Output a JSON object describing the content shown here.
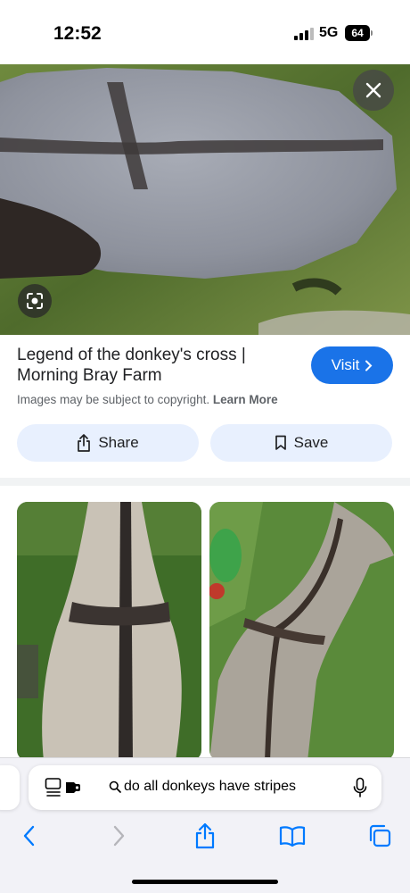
{
  "status_bar": {
    "time": "12:52",
    "network": "5G",
    "battery": "64"
  },
  "hero": {
    "image_icon": "donkey-back-photo",
    "close_icon": "close-icon",
    "lens_icon": "lens-icon"
  },
  "result": {
    "title": "Legend of the donkey's cross | Morning Bray Farm",
    "visit_label": "Visit",
    "copyright_text": "Images may be subject to copyright.",
    "learn_more_label": "Learn More"
  },
  "actions": {
    "share_label": "Share",
    "save_label": "Save"
  },
  "browser": {
    "search_query": "do all donkeys have stripes"
  },
  "colors": {
    "accent": "#1a73e8",
    "action_bg": "#e8f0fe",
    "toolbar_tint": "#007aff"
  }
}
